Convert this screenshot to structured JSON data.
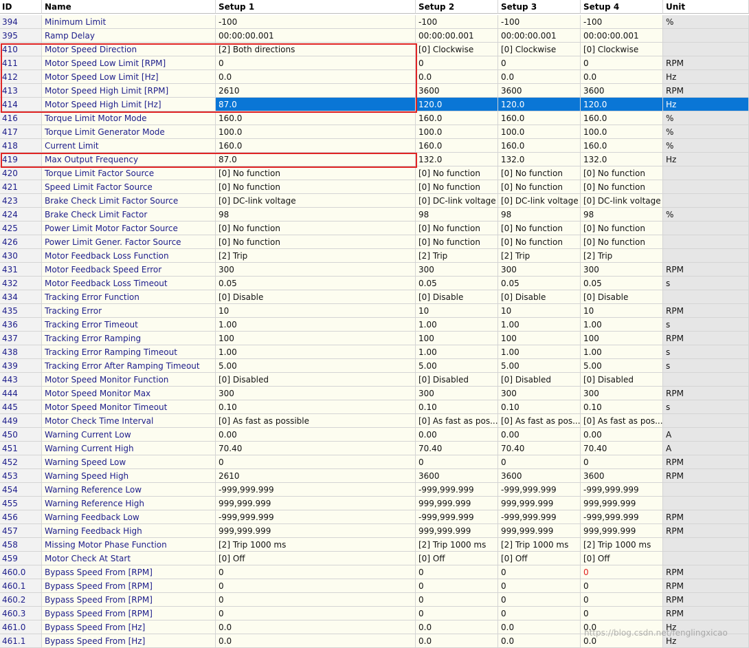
{
  "columns": [
    "ID",
    "Name",
    "Setup 1",
    "Setup 2",
    "Setup 3",
    "Setup 4",
    "Unit"
  ],
  "selected_row_id": "414",
  "highlighted_cell_color": "#e02020",
  "highlight_box_color": "#e02424",
  "selection_color": "#0a76d6",
  "rows": [
    [
      "394",
      "Minimum Limit",
      "-100",
      "-100",
      "-100",
      "-100",
      "%"
    ],
    [
      "395",
      "Ramp Delay",
      "00:00:00.001",
      "00:00:00.001",
      "00:00:00.001",
      "00:00:00.001",
      ""
    ],
    [
      "410",
      "Motor Speed Direction",
      "[2] Both directions",
      "[0] Clockwise",
      "[0] Clockwise",
      "[0] Clockwise",
      ""
    ],
    [
      "411",
      "Motor Speed Low Limit [RPM]",
      "0",
      "0",
      "0",
      "0",
      "RPM"
    ],
    [
      "412",
      "Motor Speed Low Limit [Hz]",
      "0.0",
      "0.0",
      "0.0",
      "0.0",
      "Hz"
    ],
    [
      "413",
      "Motor Speed High Limit [RPM]",
      "2610",
      "3600",
      "3600",
      "3600",
      "RPM"
    ],
    [
      "414",
      "Motor Speed High Limit [Hz]",
      "87.0",
      "120.0",
      "120.0",
      "120.0",
      "Hz"
    ],
    [
      "416",
      "Torque Limit Motor Mode",
      "160.0",
      "160.0",
      "160.0",
      "160.0",
      "%"
    ],
    [
      "417",
      "Torque Limit Generator Mode",
      "100.0",
      "100.0",
      "100.0",
      "100.0",
      "%"
    ],
    [
      "418",
      "Current Limit",
      "160.0",
      "160.0",
      "160.0",
      "160.0",
      "%"
    ],
    [
      "419",
      "Max Output Frequency",
      "87.0",
      "132.0",
      "132.0",
      "132.0",
      "Hz"
    ],
    [
      "420",
      "Torque Limit Factor Source",
      "[0] No function",
      "[0] No function",
      "[0] No function",
      "[0] No function",
      ""
    ],
    [
      "421",
      "Speed Limit Factor Source",
      "[0] No function",
      "[0] No function",
      "[0] No function",
      "[0] No function",
      ""
    ],
    [
      "423",
      "Brake Check Limit Factor Source",
      "[0] DC-link voltage",
      "[0] DC-link voltage",
      "[0] DC-link voltage",
      "[0] DC-link voltage",
      ""
    ],
    [
      "424",
      "Brake Check Limit Factor",
      "98",
      "98",
      "98",
      "98",
      "%"
    ],
    [
      "425",
      "Power Limit Motor Factor Source",
      "[0] No function",
      "[0] No function",
      "[0] No function",
      "[0] No function",
      ""
    ],
    [
      "426",
      "Power Limit Gener. Factor Source",
      "[0] No function",
      "[0] No function",
      "[0] No function",
      "[0] No function",
      ""
    ],
    [
      "430",
      "Motor Feedback Loss Function",
      "[2] Trip",
      "[2] Trip",
      "[2] Trip",
      "[2] Trip",
      ""
    ],
    [
      "431",
      "Motor Feedback Speed Error",
      "300",
      "300",
      "300",
      "300",
      "RPM"
    ],
    [
      "432",
      "Motor Feedback Loss Timeout",
      "0.05",
      "0.05",
      "0.05",
      "0.05",
      "s"
    ],
    [
      "434",
      "Tracking Error Function",
      "[0] Disable",
      "[0] Disable",
      "[0] Disable",
      "[0] Disable",
      ""
    ],
    [
      "435",
      "Tracking Error",
      "10",
      "10",
      "10",
      "10",
      "RPM"
    ],
    [
      "436",
      "Tracking Error Timeout",
      "1.00",
      "1.00",
      "1.00",
      "1.00",
      "s"
    ],
    [
      "437",
      "Tracking Error Ramping",
      "100",
      "100",
      "100",
      "100",
      "RPM"
    ],
    [
      "438",
      "Tracking Error Ramping Timeout",
      "1.00",
      "1.00",
      "1.00",
      "1.00",
      "s"
    ],
    [
      "439",
      "Tracking Error After Ramping Timeout",
      "5.00",
      "5.00",
      "5.00",
      "5.00",
      "s"
    ],
    [
      "443",
      "Motor Speed Monitor Function",
      "[0] Disabled",
      "[0] Disabled",
      "[0] Disabled",
      "[0] Disabled",
      ""
    ],
    [
      "444",
      "Motor Speed Monitor Max",
      "300",
      "300",
      "300",
      "300",
      "RPM"
    ],
    [
      "445",
      "Motor Speed Monitor Timeout",
      "0.10",
      "0.10",
      "0.10",
      "0.10",
      "s"
    ],
    [
      "449",
      "Motor Check Time Interval",
      "[0] As fast as possible",
      "[0] As fast as pos...",
      "[0] As fast as pos...",
      "[0] As fast as pos...",
      ""
    ],
    [
      "450",
      "Warning Current Low",
      "0.00",
      "0.00",
      "0.00",
      "0.00",
      "A"
    ],
    [
      "451",
      "Warning Current High",
      "70.40",
      "70.40",
      "70.40",
      "70.40",
      "A"
    ],
    [
      "452",
      "Warning Speed Low",
      "0",
      "0",
      "0",
      "0",
      "RPM"
    ],
    [
      "453",
      "Warning Speed High",
      "2610",
      "3600",
      "3600",
      "3600",
      "RPM"
    ],
    [
      "454",
      "Warning Reference Low",
      "-999,999.999",
      "-999,999.999",
      "-999,999.999",
      "-999,999.999",
      ""
    ],
    [
      "455",
      "Warning Reference High",
      "999,999.999",
      "999,999.999",
      "999,999.999",
      "999,999.999",
      ""
    ],
    [
      "456",
      "Warning Feedback Low",
      "-999,999.999",
      "-999,999.999",
      "-999,999.999",
      "-999,999.999",
      "RPM"
    ],
    [
      "457",
      "Warning Feedback High",
      "999,999.999",
      "999,999.999",
      "999,999.999",
      "999,999.999",
      "RPM"
    ],
    [
      "458",
      "Missing Motor Phase Function",
      "[2] Trip 1000 ms",
      "[2] Trip 1000 ms",
      "[2] Trip 1000 ms",
      "[2] Trip 1000 ms",
      ""
    ],
    [
      "459",
      "Motor Check At Start",
      "[0] Off",
      "[0] Off",
      "[0] Off",
      "[0] Off",
      ""
    ],
    [
      "460.0",
      "Bypass Speed From [RPM]",
      "0",
      "0",
      "0",
      "0",
      "RPM"
    ],
    [
      "460.1",
      "Bypass Speed From [RPM]",
      "0",
      "0",
      "0",
      "0",
      "RPM"
    ],
    [
      "460.2",
      "Bypass Speed From [RPM]",
      "0",
      "0",
      "0",
      "0",
      "RPM"
    ],
    [
      "460.3",
      "Bypass Speed From [RPM]",
      "0",
      "0",
      "0",
      "0",
      "RPM"
    ],
    [
      "461.0",
      "Bypass Speed From [Hz]",
      "0.0",
      "0.0",
      "0.0",
      "0.0",
      "Hz"
    ],
    [
      "461.1",
      "Bypass Speed From [Hz]",
      "0.0",
      "0.0",
      "0.0",
      "0.0",
      "Hz"
    ]
  ],
  "red_value_cells": [
    {
      "row_id": "460.0",
      "column": 5
    }
  ],
  "watermark": "https://blog.csdn.net/fenglingxicao"
}
